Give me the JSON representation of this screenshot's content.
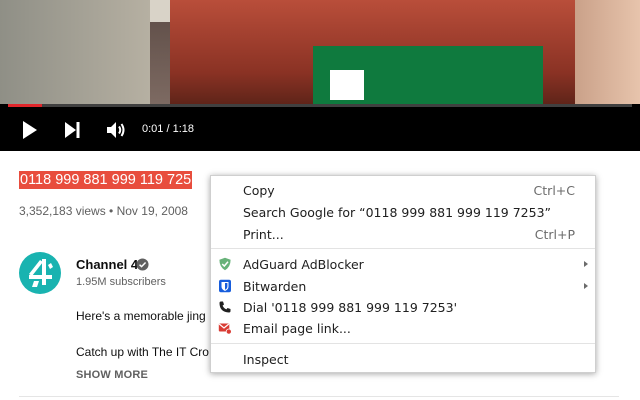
{
  "player": {
    "time": "0:01 / 1:18",
    "progress_fraction": 0.055,
    "accent_color": "#e0262b",
    "icons": [
      "play-icon",
      "next-icon",
      "volume-icon"
    ]
  },
  "video": {
    "title_selected": "0118 999 881 999 119 725",
    "title_rest": "",
    "stats": "3,352,183 views • Nov 19, 2008"
  },
  "channel": {
    "name": "Channel 4",
    "subscribers": "1.95M subscribers"
  },
  "description": {
    "line1": "Here's a memorable jing",
    "line2": "Catch up with The IT Cro",
    "show_more": "SHOW MORE"
  },
  "context_menu": {
    "copy": {
      "label": "Copy",
      "shortcut": "Ctrl+C"
    },
    "search": {
      "label": "Search Google for “0118 999 881 999 119 7253”"
    },
    "print": {
      "label": "Print...",
      "shortcut": "Ctrl+P"
    },
    "adguard": {
      "label": "AdGuard AdBlocker",
      "icon": "adguard-shield-icon"
    },
    "bitwarden": {
      "label": "Bitwarden",
      "icon": "bitwarden-icon"
    },
    "dial": {
      "label": "Dial '0118 999 881 999 119 7253'",
      "icon": "phone-icon"
    },
    "email": {
      "label": "Email page link...",
      "icon": "email-icon"
    },
    "inspect": {
      "label": "Inspect"
    }
  }
}
